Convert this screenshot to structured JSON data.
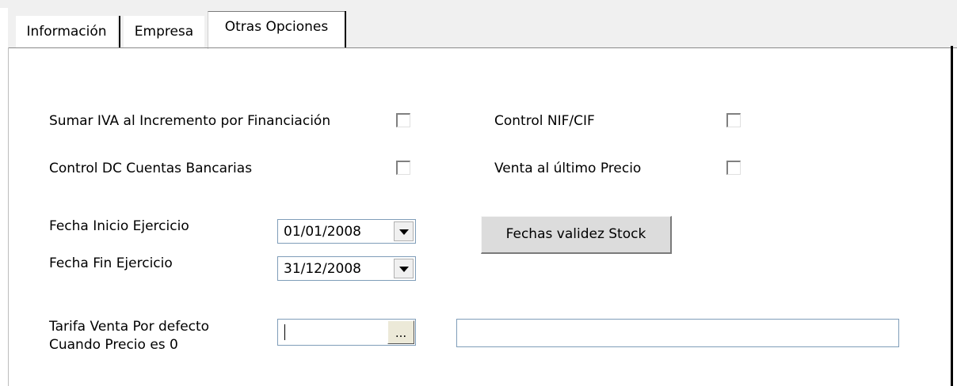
{
  "tabs": [
    {
      "label": "Información"
    },
    {
      "label": "Empresa"
    },
    {
      "label": "Otras Opciones"
    }
  ],
  "options": {
    "sumar_iva": {
      "label": "Sumar IVA al Incremento por Financiación",
      "checked": false
    },
    "control_nif": {
      "label": "Control NIF/CIF",
      "checked": false
    },
    "control_dc": {
      "label": "Control DC Cuentas Bancarias",
      "checked": false
    },
    "venta_ultimo": {
      "label": "Venta al último Precio",
      "checked": false
    }
  },
  "fecha_inicio": {
    "label": "Fecha Inicio Ejercicio",
    "value": "01/01/2008"
  },
  "fecha_fin": {
    "label": "Fecha Fin Ejercicio",
    "value": "31/12/2008"
  },
  "stock_button": {
    "label": "Fechas validez Stock"
  },
  "tarifa": {
    "label_line1": "Tarifa Venta Por defecto",
    "label_line2": "Cuando Precio es 0",
    "value": "",
    "browse_label": "...",
    "description": ""
  }
}
